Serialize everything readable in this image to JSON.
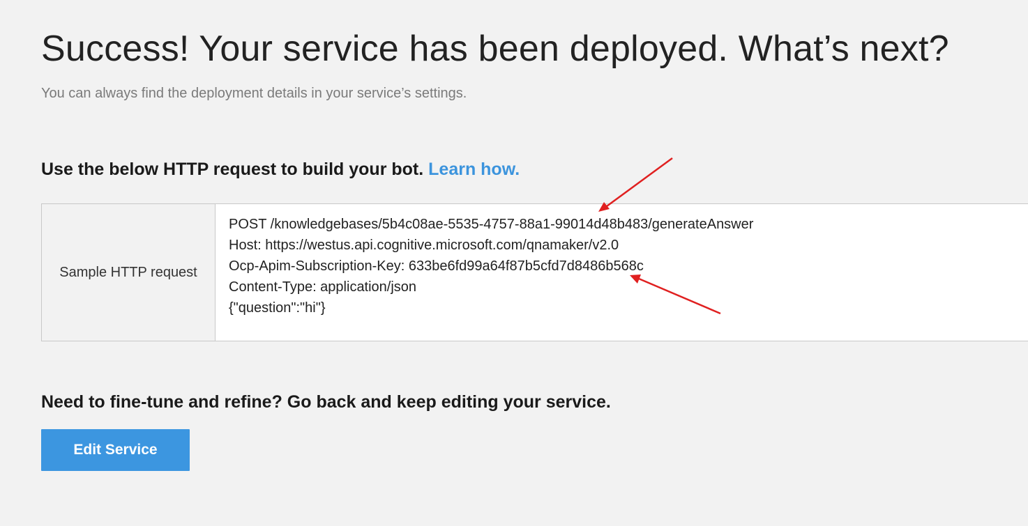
{
  "header": {
    "title": "Success! Your service has been deployed. What’s next?",
    "subtitle": "You can always find the deployment details in your service’s settings."
  },
  "http_section": {
    "heading": "Use the below HTTP request to build your bot.",
    "learn_link": "Learn how.",
    "table": {
      "label": "Sample HTTP request",
      "lines": [
        "POST /knowledgebases/5b4c08ae-5535-4757-88a1-99014d48b483/generateAnswer",
        "Host: https://westus.api.cognitive.microsoft.com/qnamaker/v2.0",
        "Ocp-Apim-Subscription-Key: 633be6fd99a64f87b5cfd7d8486b568c",
        "Content-Type: application/json",
        "{\"question\":\"hi\"}"
      ]
    }
  },
  "refine_section": {
    "heading": "Need to fine-tune and refine? Go back and keep editing your service.",
    "edit_button": "Edit Service"
  },
  "colors": {
    "background": "#f2f2f2",
    "accent": "#3c96e0",
    "link": "#3c94dd",
    "annotation_arrow": "#e02020"
  }
}
